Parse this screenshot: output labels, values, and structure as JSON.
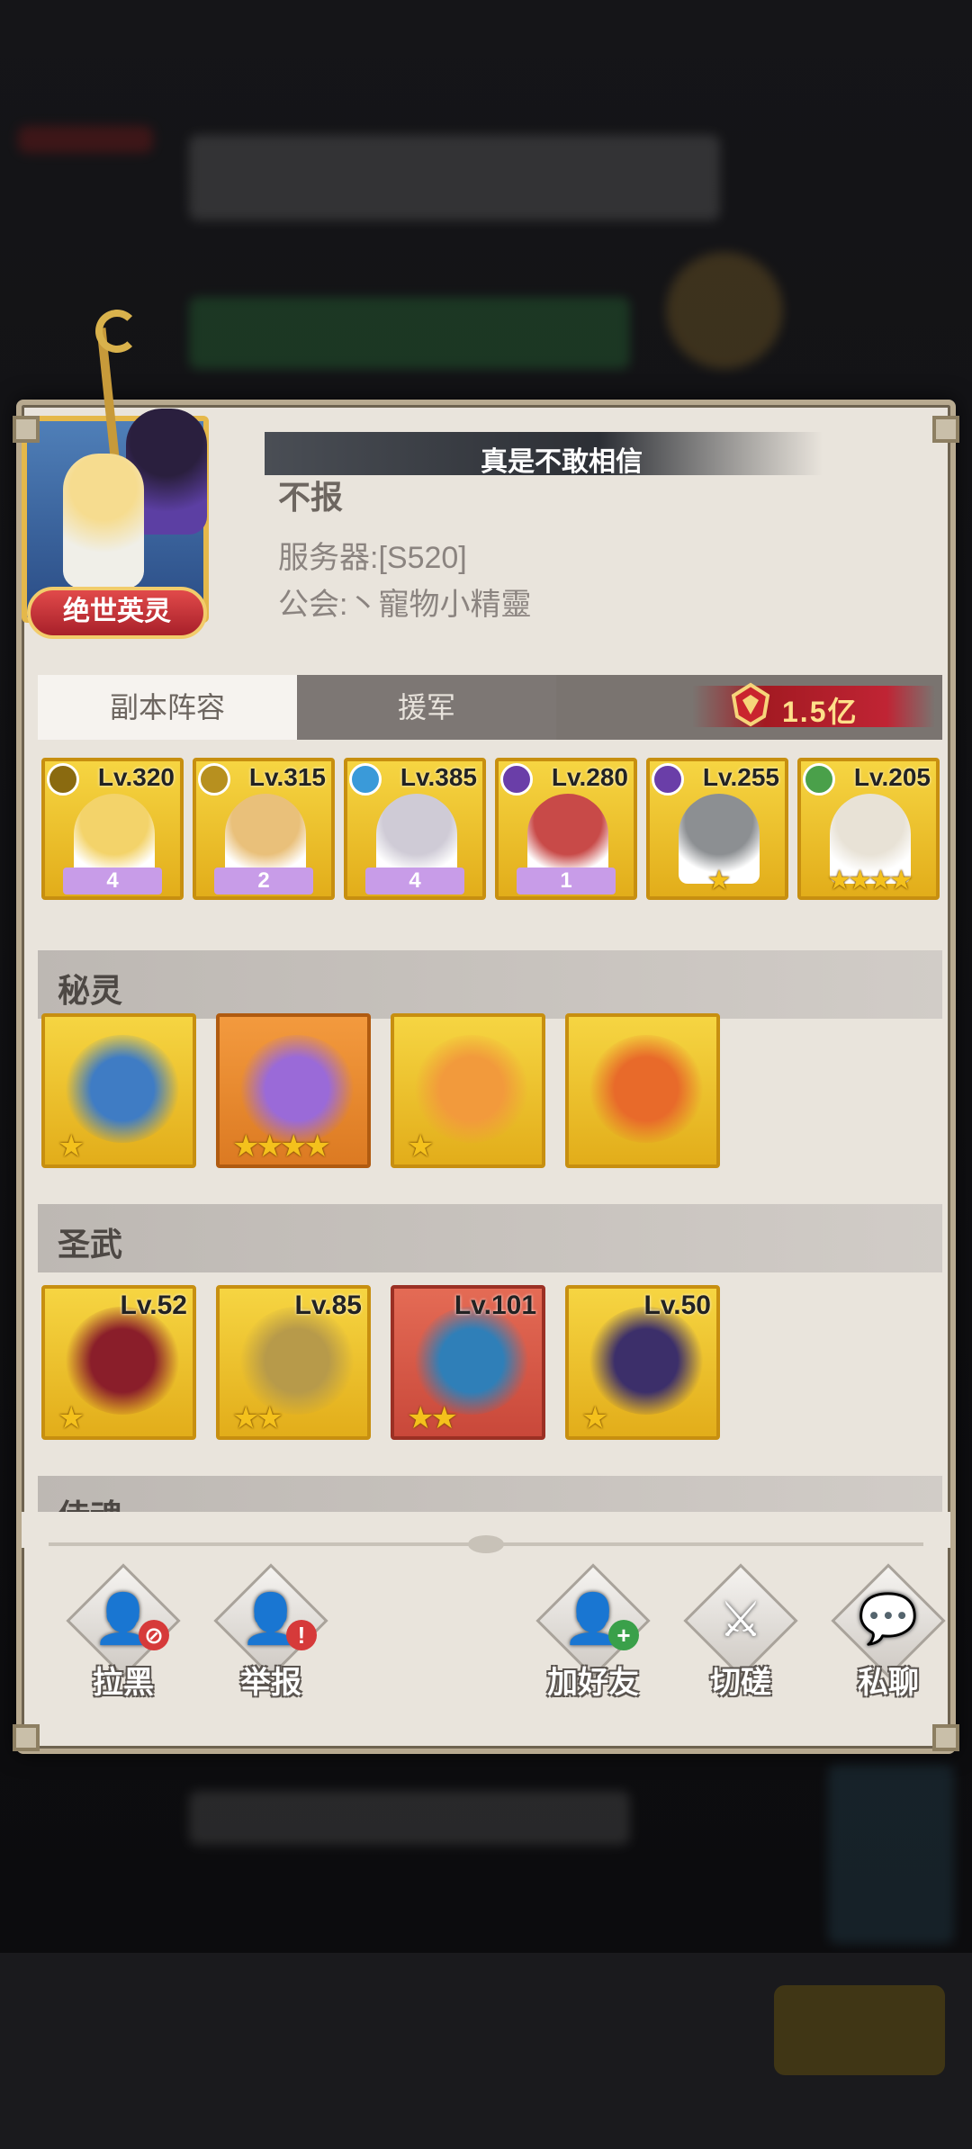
{
  "marquee": "真是不敢相信",
  "player": {
    "name": "不报",
    "server": "服务器:[S520]",
    "guild": "公会:丶寵物小精靈",
    "title_badge": "绝世英灵"
  },
  "tabs": [
    {
      "label": "副本阵容",
      "active": true
    },
    {
      "label": "援军",
      "active": false
    }
  ],
  "power": "1.5亿",
  "heroes": [
    {
      "level": "Lv.320",
      "rank": "4",
      "color": "#f3d36a",
      "elem_color": "#8a6a10"
    },
    {
      "level": "Lv.315",
      "rank": "2",
      "color": "#e9c07a",
      "elem_color": "#b7901f"
    },
    {
      "level": "Lv.385",
      "rank": "4",
      "color": "#cfcbd6",
      "elem_color": "#3a9ad9"
    },
    {
      "level": "Lv.280",
      "rank": "1",
      "color": "#c84a48",
      "elem_color": "#6a3ea8"
    },
    {
      "level": "Lv.255",
      "stars": "★",
      "color": "#8c8f92",
      "elem_color": "#6a3ea8"
    },
    {
      "level": "Lv.205",
      "stars": "★★★★",
      "color": "#e8e2d6",
      "elem_color": "#4aa04a"
    }
  ],
  "sections": {
    "spirits": "秘灵",
    "weapons": "圣武",
    "souls": "侍魂"
  },
  "spirits": [
    {
      "stars": "★",
      "tone": "gold",
      "art": "#3f7cc4"
    },
    {
      "stars": "★★★★",
      "tone": "orange",
      "art": "#9a6ad8"
    },
    {
      "stars": "★",
      "tone": "gold",
      "art": "#f29a3c"
    },
    {
      "stars": "",
      "tone": "gold",
      "art": "#e86a2a"
    }
  ],
  "weapons": [
    {
      "level": "Lv.52",
      "stars": "★",
      "tone": "gold",
      "art": "#8a1e2a"
    },
    {
      "level": "Lv.85",
      "stars": "★★",
      "tone": "gold",
      "art": "#b79a4a"
    },
    {
      "level": "Lv.101",
      "stars": "★★",
      "tone": "red",
      "art": "#2f7fb8"
    },
    {
      "level": "Lv.50",
      "stars": "★",
      "tone": "gold",
      "art": "#3c2f6a"
    }
  ],
  "actions": [
    {
      "label": "拉黑",
      "glyph": "👤",
      "badge": "⊘",
      "badge_color": "#d63a3a"
    },
    {
      "label": "举报",
      "glyph": "👤",
      "badge": "!",
      "badge_color": "#d63a3a"
    },
    {
      "label": "加好友",
      "glyph": "👤",
      "badge": "+",
      "badge_color": "#3aa04a"
    },
    {
      "label": "切磋",
      "glyph": "⚔",
      "badge": "",
      "badge_color": ""
    },
    {
      "label": "私聊",
      "glyph": "💬",
      "badge": "",
      "badge_color": ""
    }
  ]
}
